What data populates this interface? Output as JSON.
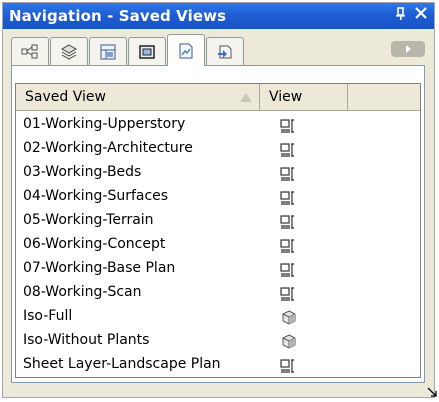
{
  "window": {
    "title": "Navigation - Saved Views",
    "pin_glyph": "Ԅ",
    "close_glyph": "✕"
  },
  "tabs": [
    {
      "icon": "classes-icon",
      "label": ""
    },
    {
      "icon": "layers-icon",
      "label": ""
    },
    {
      "icon": "sheet-layers-icon",
      "label": ""
    },
    {
      "icon": "viewports-icon",
      "label": ""
    },
    {
      "icon": "saved-views-icon",
      "label": "",
      "active": true
    },
    {
      "icon": "references-icon",
      "label": ""
    }
  ],
  "table": {
    "columns": [
      "Saved View",
      "View"
    ],
    "sort_column": "Saved View",
    "rows": [
      {
        "name": "01-Working-Upperstory",
        "view_icon": "plan-view-icon"
      },
      {
        "name": "02-Working-Architecture",
        "view_icon": "plan-view-icon"
      },
      {
        "name": "03-Working-Beds",
        "view_icon": "plan-view-icon"
      },
      {
        "name": "04-Working-Surfaces",
        "view_icon": "plan-view-icon"
      },
      {
        "name": "05-Working-Terrain",
        "view_icon": "plan-view-icon"
      },
      {
        "name": "06-Working-Concept",
        "view_icon": "plan-view-icon"
      },
      {
        "name": "07-Working-Base Plan",
        "view_icon": "plan-view-icon"
      },
      {
        "name": "08-Working-Scan",
        "view_icon": "plan-view-icon"
      },
      {
        "name": "Iso-Full",
        "view_icon": "iso-view-icon"
      },
      {
        "name": "Iso-Without Plants",
        "view_icon": "iso-view-icon"
      },
      {
        "name": "Sheet Layer-Landscape Plan",
        "view_icon": "plan-view-icon"
      }
    ]
  },
  "colors": {
    "titlebar": "#1f5ed3",
    "window_bg": "#ece9d8",
    "panel_border": "#7f9db9"
  }
}
